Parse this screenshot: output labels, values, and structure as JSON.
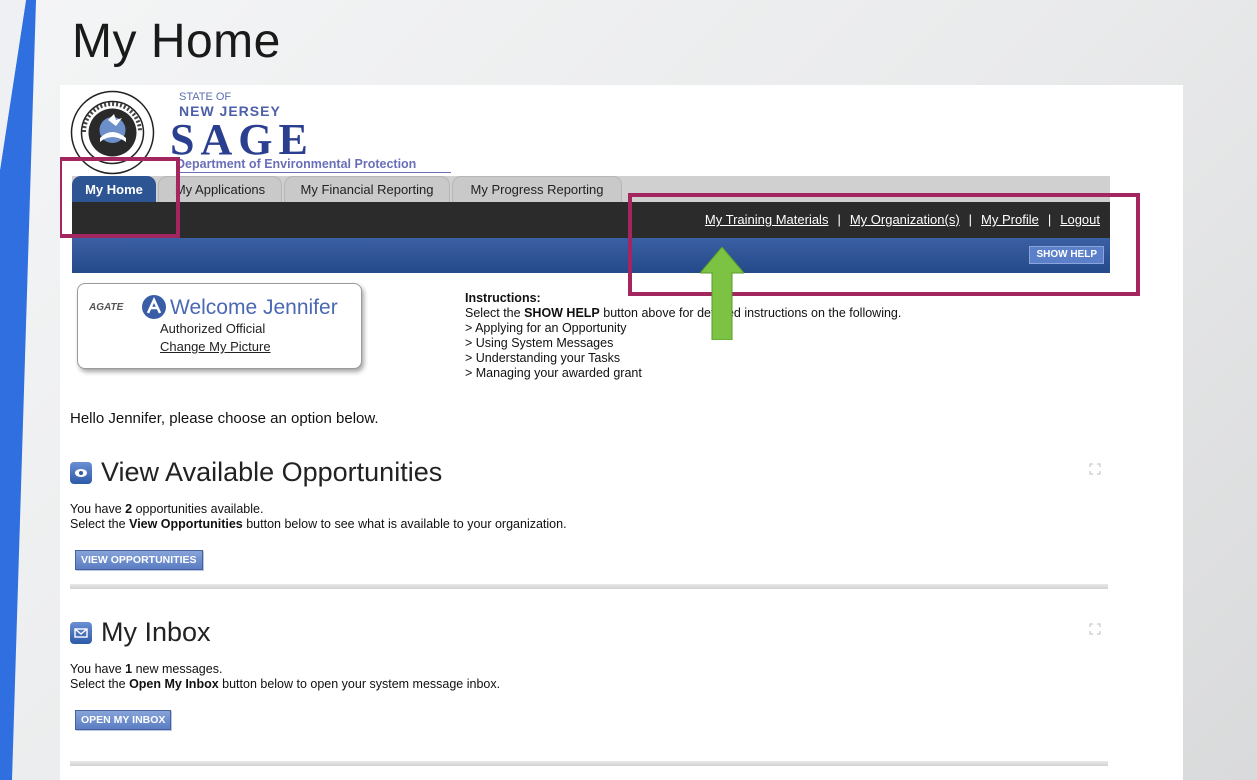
{
  "slide": {
    "title": "My Home"
  },
  "brand": {
    "state_of": "STATE OF",
    "new_jersey": "NEW JERSEY",
    "sage": "SAGE",
    "department": "Department of Environmental Protection",
    "seal_text_top": "DEPARTMENT OF ENVIRONMENTAL PROTECTION",
    "seal_text_bottom": "NEW JERSEY"
  },
  "tabs": [
    {
      "label": "My Home",
      "active": true
    },
    {
      "label": "My Applications",
      "active": false
    },
    {
      "label": "My Financial Reporting",
      "active": false
    },
    {
      "label": "My Progress Reporting",
      "active": false
    }
  ],
  "toplinks": {
    "training": "My Training Materials",
    "organization": "My Organization(s)",
    "profile": "My Profile",
    "logout": "Logout",
    "separator": "|"
  },
  "show_help": "SHOW HELP",
  "welcome": {
    "agate_logo": "AGATE",
    "greeting": "Welcome Jennifer",
    "role": "Authorized Official",
    "change_picture": "Change My Picture"
  },
  "instructions": {
    "heading": "Instructions:",
    "line1_pre": "Select the ",
    "line1_bold": "SHOW HELP",
    "line1_post": " button above for detailed instructions on the following.",
    "items": [
      "> Applying for an Opportunity",
      "> Using System Messages",
      "> Understanding your Tasks",
      "> Managing your awarded grant"
    ]
  },
  "hello": "Hello Jennifer, please choose an option below.",
  "opportunities": {
    "title": "View Available Opportunities",
    "line1_pre": "You have ",
    "line1_count": "2",
    "line1_post": " opportunities available.",
    "line2_pre": "Select the ",
    "line2_bold": "View Opportunities",
    "line2_post": " button below to see what is available to your organization.",
    "button": "VIEW OPPORTUNITIES"
  },
  "inbox": {
    "title": "My Inbox",
    "line1_pre": "You have ",
    "line1_count": "1",
    "line1_post": " new messages.",
    "line2_pre": "Select the ",
    "line2_bold": "Open My Inbox",
    "line2_post": " button below to open your system message inbox.",
    "button": "OPEN MY INBOX"
  },
  "colors": {
    "annotation_box": "#a3275e",
    "annotation_arrow": "#7cc243",
    "tab_active": "#2d5493",
    "nav_dark": "#2b2b2b",
    "accent_bar": "#2f6fe0"
  }
}
